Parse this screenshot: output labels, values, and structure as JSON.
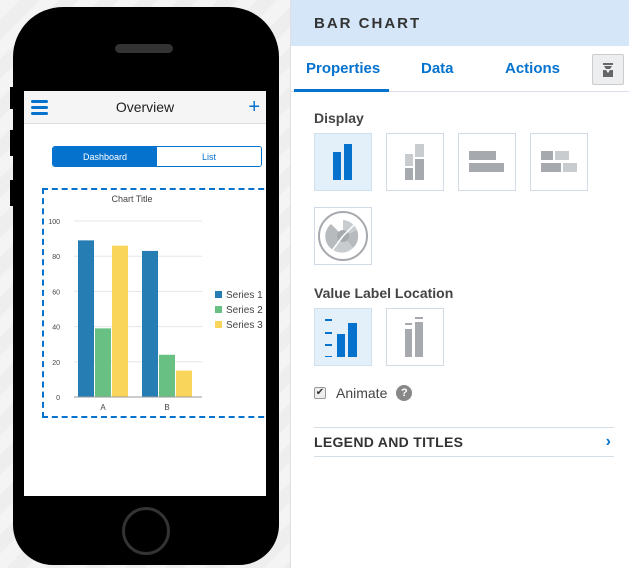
{
  "phone": {
    "app_title": "Overview",
    "menu_icon": "hamburger-icon",
    "add_icon": "plus-icon",
    "add_glyph": "+",
    "segments": [
      {
        "label": "Dashboard",
        "active": true
      },
      {
        "label": "List",
        "active": false
      }
    ]
  },
  "chart_data": {
    "type": "bar",
    "title": "Chart Title",
    "categories": [
      "A",
      "B"
    ],
    "series": [
      {
        "name": "Series 1",
        "color": "#267db3",
        "values": [
          89,
          83
        ]
      },
      {
        "name": "Series 2",
        "color": "#68c182",
        "values": [
          39,
          24
        ]
      },
      {
        "name": "Series 3",
        "color": "#fad55c",
        "values": [
          86,
          15
        ]
      }
    ],
    "ylim": [
      0,
      100
    ],
    "yticks": [
      0,
      20,
      40,
      60,
      80,
      100
    ],
    "xlabel": "",
    "ylabel": "",
    "grid": true,
    "legend": "right"
  },
  "panel": {
    "title": "BAR CHART",
    "tabs": [
      "Properties",
      "Data",
      "Actions"
    ],
    "active_tab": "Properties",
    "collapse_icon": "collapse-panel-icon",
    "display_label": "Display",
    "display_options": [
      {
        "name": "bar-vertical",
        "selected": true
      },
      {
        "name": "bar-stacked-vertical",
        "selected": false
      },
      {
        "name": "bar-horizontal",
        "selected": false
      },
      {
        "name": "bar-stacked-horizontal",
        "selected": false
      },
      {
        "name": "polar",
        "selected": false
      }
    ],
    "value_label_location_label": "Value Label Location",
    "value_label_options": [
      {
        "name": "axis-labels",
        "selected": true
      },
      {
        "name": "labels-on-bars",
        "selected": false
      }
    ],
    "animate_label": "Animate",
    "animate_checked": true,
    "checkmark": "✔",
    "help_glyph": "?",
    "legend_section_title": "LEGEND AND TITLES",
    "chevron_glyph": "›",
    "accent_color": "#0572ce"
  }
}
